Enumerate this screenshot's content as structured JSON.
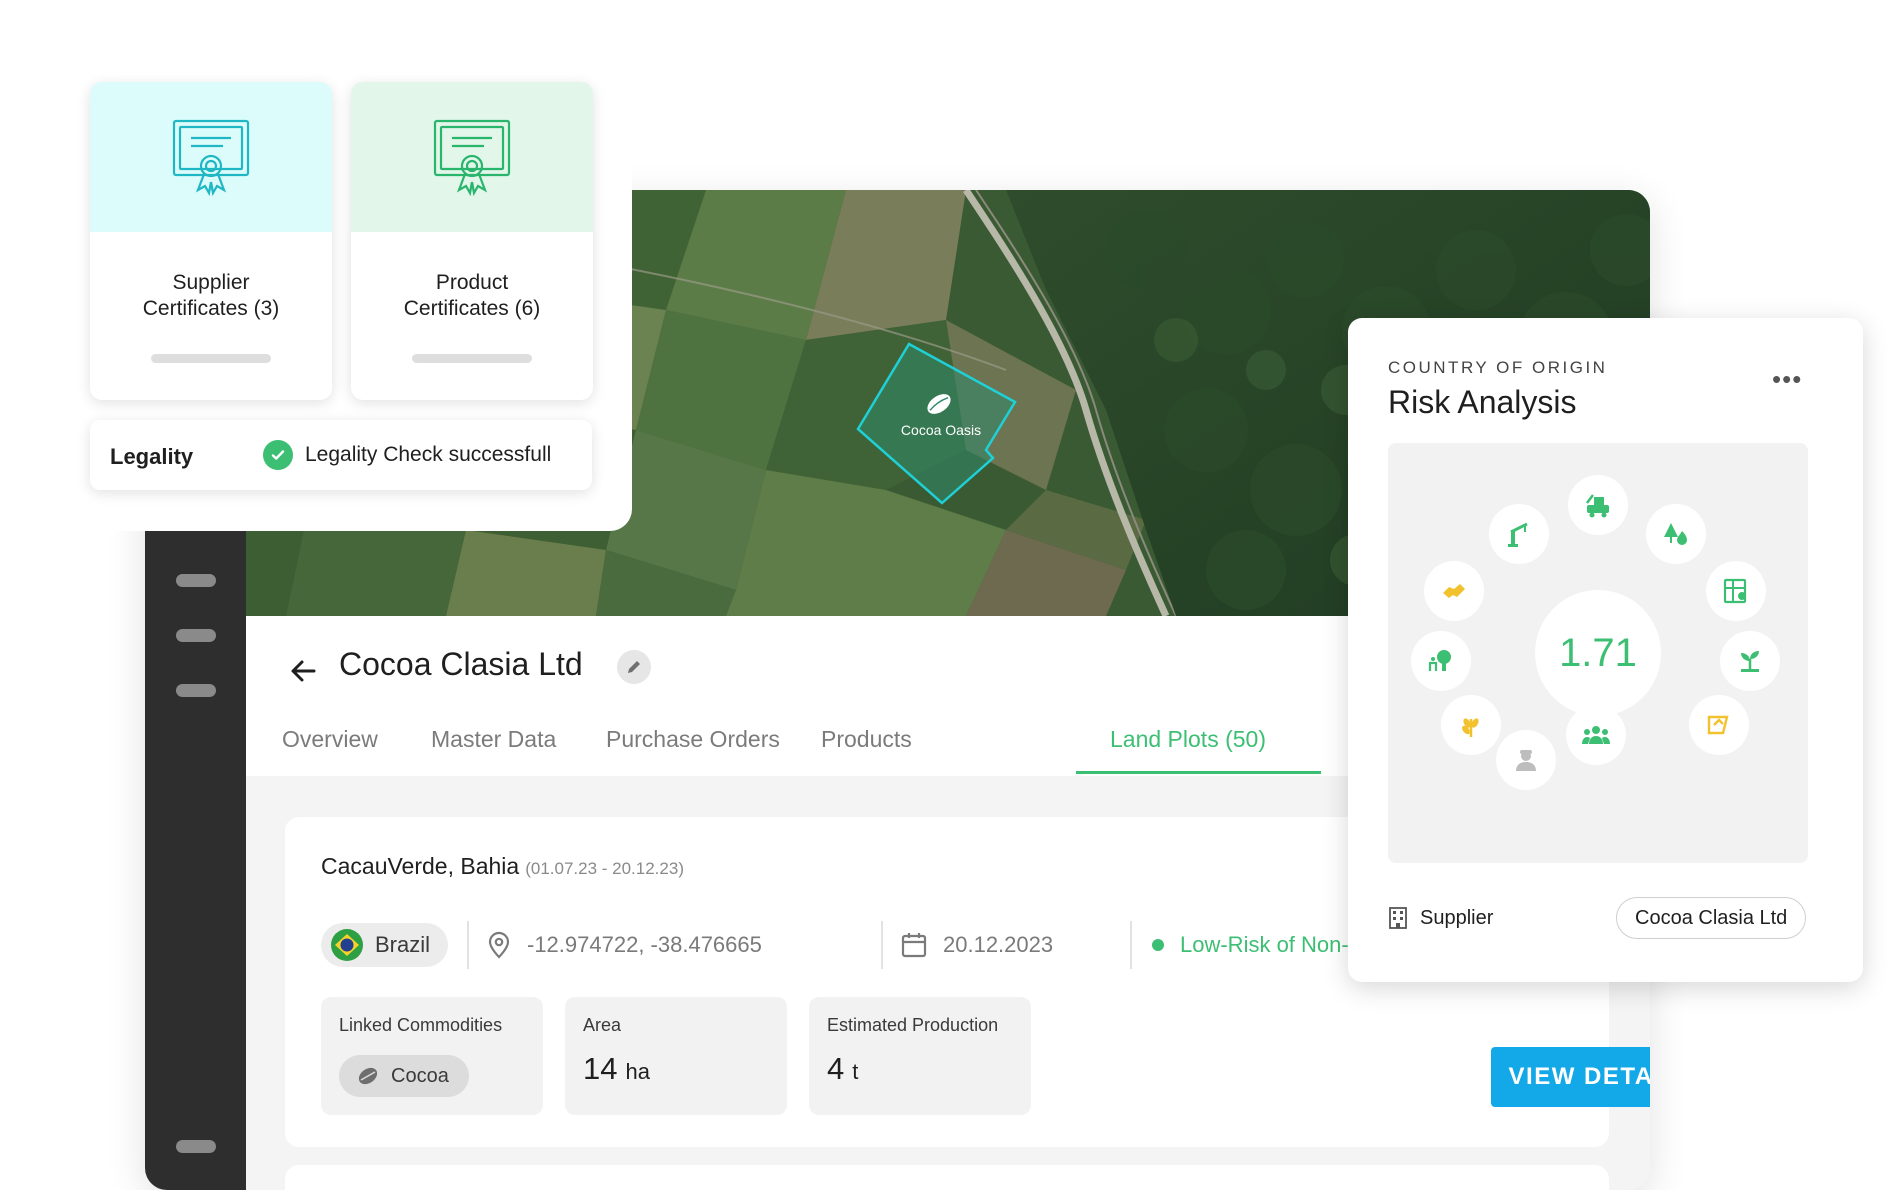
{
  "certificates": {
    "supplier": {
      "line1": "Supplier",
      "line2": "Certificates (3)",
      "tint": "#dcfcfb",
      "icon_color": "#1fb7c4",
      "icon": "certificate-icon"
    },
    "product": {
      "line1": "Product",
      "line2": "Certificates (6)",
      "tint": "#e2f6ea",
      "icon_color": "#2ab56c",
      "icon": "certificate-icon"
    }
  },
  "legality": {
    "label": "Legality",
    "status": "Legality Check successfull",
    "icon": "check-circle-icon"
  },
  "map": {
    "plot_label": "Cocoa Oasis",
    "plot_icon": "cocoa-bean-icon",
    "outline_color": "#1fd0d6"
  },
  "header": {
    "title": "Cocoa Clasia Ltd",
    "tabs": [
      {
        "label": "Overview",
        "active": false
      },
      {
        "label": "Master Data",
        "active": false
      },
      {
        "label": "Purchase Orders",
        "active": false
      },
      {
        "label": "Products",
        "active": false
      },
      {
        "label": "Land Plots (50)",
        "active": true
      }
    ]
  },
  "plot": {
    "name": "CacauVerde, Bahia",
    "dates": "(01.07.23 - 20.12.23)",
    "country": "Brazil",
    "coordinates": "-12.974722, -38.476665",
    "date": "20.12.2023",
    "risk": "Low-Risk of Non-Complaince",
    "stats": {
      "commodities_label": "Linked Commodities",
      "commodity": "Cocoa",
      "area_label": "Area",
      "area_value": "14",
      "area_unit": "ha",
      "production_label": "Estimated Production",
      "production_value": "4",
      "production_unit": "t"
    },
    "view_details": "VIEW DETAILS"
  },
  "risk": {
    "eyebrow": "COUNTRY OF ORIGIN",
    "title": "Risk Analysis",
    "more": "•••",
    "score": "1.71",
    "supplier_label": "Supplier",
    "supplier_value": "Cocoa Clasia Ltd",
    "accent_green": "#3cbf73",
    "accent_yellow": "#f2c12e"
  },
  "accent_blue": "#13a8e8"
}
